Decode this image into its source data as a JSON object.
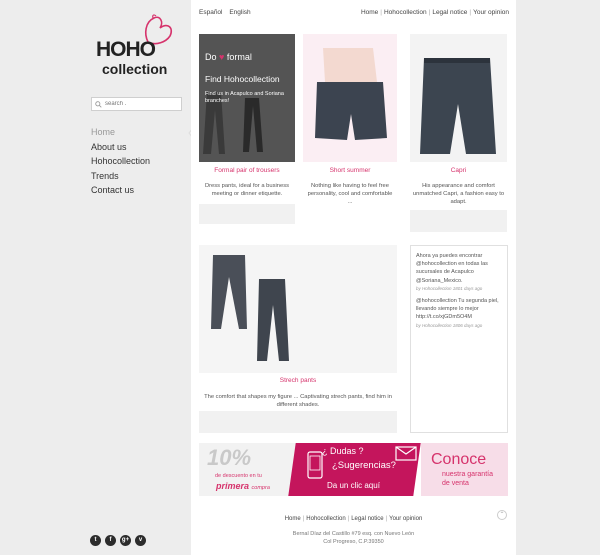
{
  "brand": {
    "logo_main": "HOHO",
    "logo_sub": "collection"
  },
  "search": {
    "placeholder": "search ."
  },
  "nav": [
    "Home",
    "About us",
    "Hohocollection",
    "Trends",
    "Contact us"
  ],
  "languages": [
    "Español",
    "English"
  ],
  "top_links": [
    "Home",
    "Hohocollection",
    "Legal notice",
    "Your opinion"
  ],
  "products": [
    {
      "title": "Formal pair of trousers",
      "description": "Dress pants, ideal for a business meeting or dinner etiquette.",
      "overlay": {
        "line1": "Do",
        "line1b": "formal",
        "line2": "Find Hohocollection",
        "line3": "Find us in Acapulco and Soriana branches!"
      }
    },
    {
      "title": "Short summer",
      "description": "Nothing like having to feel free personality, cool and comfortable ..."
    },
    {
      "title": "Capri",
      "description": "His appearance and comfort unmatched Capri, a fashion easy to adapt."
    },
    {
      "title": "Strech pants",
      "description": "The comfort that shapes my figure ... Captivating strech pants, find him in different shades."
    }
  ],
  "tweets": [
    {
      "text": "Ahora ya puedes encontrar @hohocollection en todas las sucursales de Acapulco @Soriana_Mexico.",
      "meta": "by Hohocollection 1801 days ago"
    },
    {
      "text": "@hohocollection Tu segunda piel, llevando siempre lo mejor http://t.co/xjGDm5O4M",
      "meta": "by Hohocollection 1806 days ago"
    }
  ],
  "banner": {
    "percent": "10%",
    "discount_line": "de descuento en tu",
    "first": "primera",
    "purchase": "compra",
    "dudas": "¿ Dudas ?",
    "sugerencias": "¿Sugerencias?",
    "click": "Da un clic aquí",
    "conoce": "Conoce",
    "guarantee1": "nuestra garantía",
    "guarantee2": "de venta"
  },
  "footer": {
    "links": [
      "Home",
      "Hohocollection",
      "Legal notice",
      "Your opinion"
    ],
    "address1": "Bernal Díaz del Castillo #79 esq. con Nuevo León",
    "address2": "Col Progreso, C.P.39350"
  },
  "social": [
    "t",
    "f",
    "g+",
    "v"
  ],
  "colors": {
    "accent": "#d6336c",
    "banner_magenta": "#c4155c",
    "page_bg": "#ededed"
  }
}
